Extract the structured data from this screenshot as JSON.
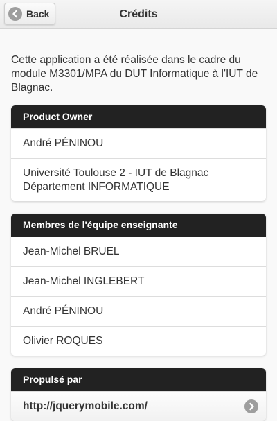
{
  "header": {
    "back_label": "Back",
    "title": "Crédits"
  },
  "intro": "Cette application a été réalisée dans le cadre du module M3301/MPA du DUT Informatique à l'IUT de Blagnac.",
  "product_owner": {
    "title": "Product Owner",
    "items": [
      "André PÉNINOU",
      "Université Toulouse 2 - IUT de Blagnac Département INFORMATIQUE"
    ]
  },
  "teachers": {
    "title": "Membres de l'équipe enseignante",
    "items": [
      "Jean-Michel BRUEL",
      "Jean-Michel INGLEBERT",
      "André PÉNINOU",
      "Olivier ROQUES"
    ]
  },
  "powered_by": {
    "title": "Propulsé par",
    "link": "http://jquerymobile.com/"
  },
  "icons": {
    "back": "chevron-left-icon",
    "link": "chevron-right-icon"
  },
  "colors": {
    "divider_bg": "#222222",
    "icon_bg": "#9e9e9e",
    "page_bg": "#f9f9f9"
  }
}
